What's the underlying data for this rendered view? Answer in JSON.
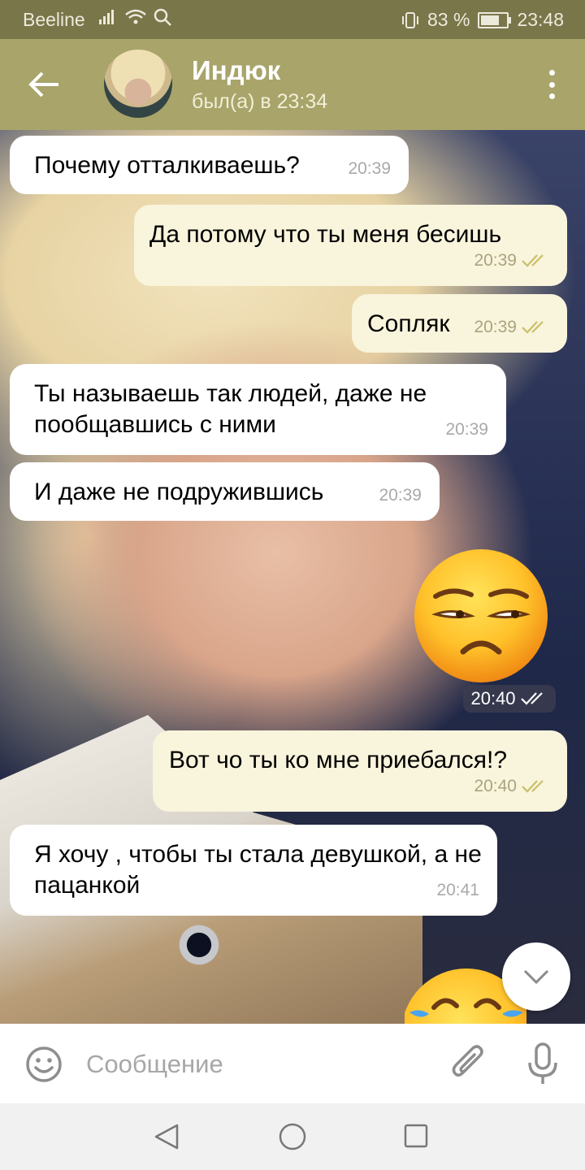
{
  "status_bar": {
    "carrier": "Beeline",
    "battery": "83 %",
    "battery_level": 0.83,
    "time": "23:48"
  },
  "header": {
    "name": "Индюк",
    "status": "был(а) в 23:34"
  },
  "messages": [
    {
      "direction": "in",
      "text": "Почему отталкиваешь?",
      "time": "20:39"
    },
    {
      "direction": "out",
      "text": "Да потому что ты меня бесишь",
      "time": "20:39",
      "read": true
    },
    {
      "direction": "out",
      "text": "Сопляк",
      "time": "20:39",
      "read": true
    },
    {
      "direction": "in",
      "text": "Ты называешь так людей, даже не пообщавшись с ними",
      "time": "20:39"
    },
    {
      "direction": "in",
      "text": "И даже не подружившись",
      "time": "20:39"
    },
    {
      "direction": "out",
      "text": "unamused-face-emoji",
      "time": "20:40",
      "read": true,
      "kind": "emoji"
    },
    {
      "direction": "out",
      "text": "Вот чо ты ко мне приебался!?",
      "time": "20:40",
      "read": true
    },
    {
      "direction": "in",
      "text": "Я хочу , чтобы ты стала девушкой, а не пацанкой",
      "time": "20:41"
    },
    {
      "direction": "out",
      "text": "tears-of-joy-emoji",
      "kind": "emoji",
      "partial": true
    }
  ],
  "input": {
    "placeholder": "Сообщение"
  },
  "colors": {
    "header": "#a8a46a",
    "status_bar": "#79764a",
    "incoming_bubble": "#ffffff",
    "outgoing_bubble": "#f9f4dc",
    "checkmarks": "#c9bf6a"
  },
  "icons": [
    "back-arrow-icon",
    "more-vert-icon",
    "double-check-icon",
    "chevron-down-icon",
    "emoji-icon",
    "paperclip-icon",
    "microphone-icon",
    "nav-back-icon",
    "nav-home-icon",
    "nav-recent-icon"
  ]
}
